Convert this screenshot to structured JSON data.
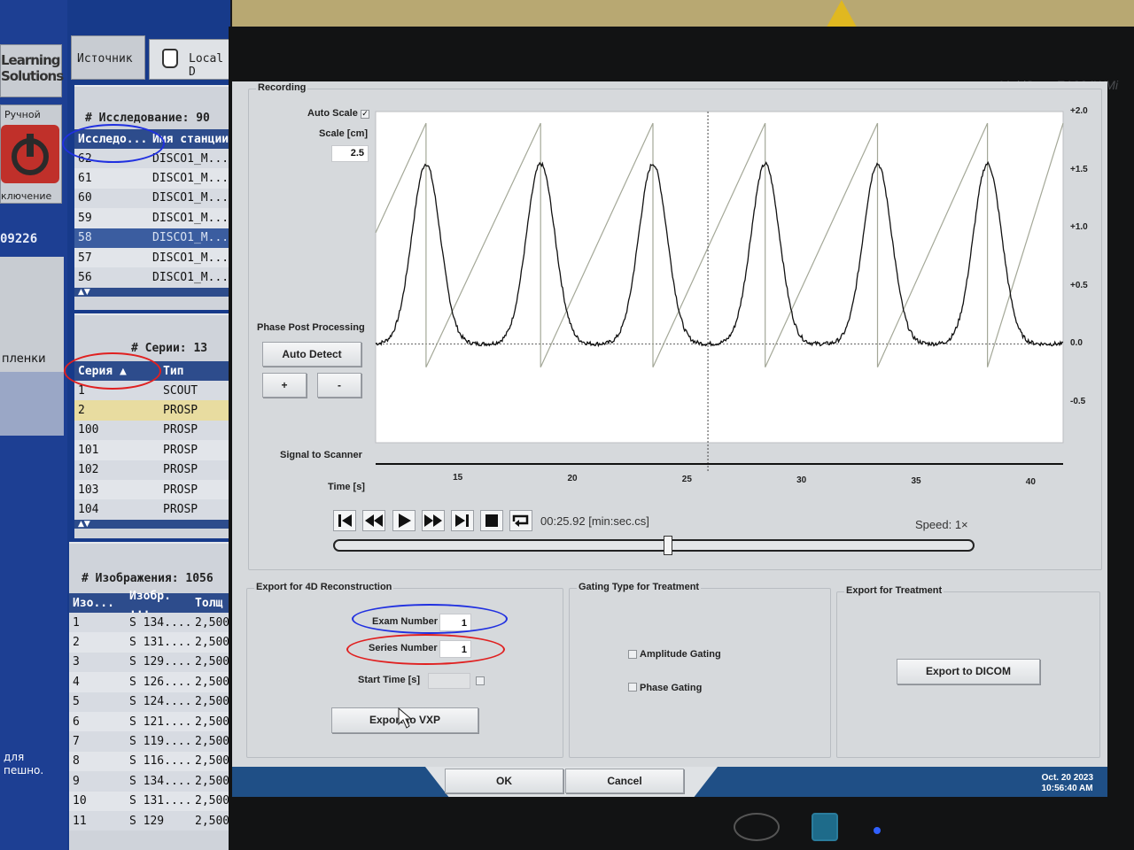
{
  "left_screen": {
    "logo_lines": [
      "Learning",
      "Solutions"
    ],
    "power_label": "Ручной",
    "power_sub": "ключение",
    "patient_id": "09226",
    "film_label": "пленки",
    "dla_lines": [
      "для",
      "пешно."
    ],
    "source_tab": "Источник",
    "local_tab": "Local D",
    "studies": {
      "title": "# Исследование:  90",
      "headers": [
        "Исследо...",
        "Имя станции"
      ],
      "rows": [
        [
          "62",
          "DISCO1_M..."
        ],
        [
          "61",
          "DISCO1_M..."
        ],
        [
          "60",
          "DISCO1_M..."
        ],
        [
          "59",
          "DISCO1_M..."
        ],
        [
          "58",
          "DISCO1_M..."
        ],
        [
          "57",
          "DISCO1_M..."
        ],
        [
          "56",
          "DISCO1_M..."
        ]
      ],
      "selected_index": 4
    },
    "series": {
      "title": "# Серии:  13",
      "headers": [
        "Серия ▲",
        "Тип"
      ],
      "rows": [
        [
          "1",
          "SCOUT"
        ],
        [
          "2",
          "PROSP"
        ],
        [
          "100",
          "PROSP"
        ],
        [
          "101",
          "PROSP"
        ],
        [
          "102",
          "PROSP"
        ],
        [
          "103",
          "PROSP"
        ],
        [
          "104",
          "PROSP"
        ]
      ],
      "highlighted_index": 1
    },
    "images": {
      "title": "# Изображения:  1056",
      "headers": [
        "Изо...",
        "Изобр. ...",
        "Толщ"
      ],
      "rows": [
        [
          "1",
          "S 134....",
          "2,500"
        ],
        [
          "2",
          "S 131....",
          "2,500"
        ],
        [
          "3",
          "S 129....",
          "2,500"
        ],
        [
          "4",
          "S 126....",
          "2,500"
        ],
        [
          "5",
          "S 124....",
          "2,500"
        ],
        [
          "6",
          "S 121....",
          "2,500"
        ],
        [
          "7",
          "S 119....",
          "2,500"
        ],
        [
          "8",
          "S 116....",
          "2,500"
        ],
        [
          "9",
          "S 134....",
          "2,500"
        ],
        [
          "10",
          "S 131....",
          "2,500"
        ],
        [
          "11",
          "S 129",
          "2,500"
        ]
      ]
    }
  },
  "monitor": {
    "brand": "MultiSync EA234WMi"
  },
  "recording": {
    "group_label": "Recording",
    "auto_scale_label": "Auto Scale",
    "auto_scale_checked": true,
    "scale_label": "Scale [cm]",
    "scale_value": "2.5",
    "phase_post_label": "Phase Post Processing",
    "auto_detect_label": "Auto Detect",
    "plus_label": "+",
    "minus_label": "-",
    "signal_label": "Signal to Scanner",
    "time_label": "Time [s]",
    "timecode": "00:25.92 [min:sec.cs]",
    "speed": "Speed: 1×",
    "playhead_fraction": 0.52
  },
  "chart_data": {
    "type": "line",
    "xlabel": "Time [s]",
    "x_ticks": [
      "15",
      "20",
      "25",
      "30",
      "35",
      "40"
    ],
    "y_ticks": [
      "+2.0",
      "+1.5",
      "+1.0",
      "+0.5",
      "0.0",
      "-0.5"
    ],
    "xlim": [
      11.4,
      41.4
    ],
    "ylim": [
      -0.85,
      2.0
    ],
    "cursor_x": 25.9,
    "series": [
      {
        "name": "",
        "kind": "breathing-amplitude",
        "peaks_x": [
          13.6,
          18.6,
          23.5,
          28.4,
          33.3,
          38.1
        ],
        "peak_y": 1.55,
        "baseline_y": 0.0
      },
      {
        "name": "",
        "kind": "phase-sawtooth",
        "reset_x": [
          13.6,
          18.6,
          23.5,
          28.4,
          33.3,
          38.1
        ],
        "low_y": -0.2,
        "high_y": 1.9
      }
    ]
  },
  "export4d": {
    "group_label": "Export for 4D Reconstruction",
    "exam_label": "Exam Number",
    "exam_value": "1",
    "series_label": "Series Number",
    "series_value": "1",
    "start_label": "Start Time [s]",
    "start_value": "",
    "vxp_button": "Export to VXP"
  },
  "gating": {
    "group_label": "Gating Type for Treatment",
    "amplitude_label": "Amplitude Gating",
    "phase_label": "Phase Gating"
  },
  "export_treatment": {
    "group_label": "Export for Treatment",
    "dicom_button": "Export to DICOM"
  },
  "footer": {
    "ok_label": "OK",
    "cancel_label": "Cancel",
    "date": "Oct. 20 2023",
    "time": "10:56:40 AM"
  }
}
